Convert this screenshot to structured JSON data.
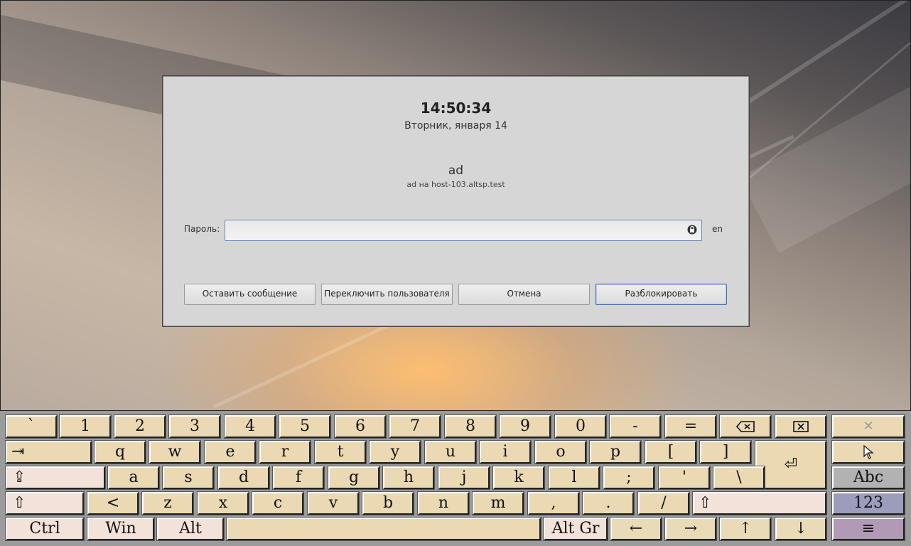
{
  "lock_screen": {
    "time": "14:50:34",
    "date": "Вторник, января 14",
    "user_name": "ad",
    "user_host": "ad на host-103.altsp.test",
    "password_label": "Пароль:",
    "password_value": "",
    "keyboard_layout": "en",
    "buttons": {
      "leave_message": "Оставить сообщение",
      "switch_user": "Переключить пользователя",
      "cancel": "Отмена",
      "unlock": "Разблокировать"
    }
  },
  "keyboard": {
    "row1": [
      "`",
      "1",
      "2",
      "3",
      "4",
      "5",
      "6",
      "7",
      "8",
      "9",
      "0",
      "-",
      "="
    ],
    "row2": [
      "q",
      "w",
      "e",
      "r",
      "t",
      "y",
      "u",
      "i",
      "o",
      "p",
      "[",
      "]"
    ],
    "row3": [
      "a",
      "s",
      "d",
      "f",
      "g",
      "h",
      "j",
      "k",
      "l",
      ";",
      "'",
      "\\"
    ],
    "row4": [
      "<",
      "z",
      "x",
      "c",
      "v",
      "b",
      "n",
      "m",
      ",",
      ".",
      "/"
    ],
    "ctrl": "Ctrl",
    "win": "Win",
    "alt": "Alt",
    "alt_gr": "Alt Gr",
    "tab": "⇥",
    "caps": "⇪",
    "shift": "⇧",
    "enter": "⏎",
    "arrows": {
      "left": "←",
      "right": "→",
      "up": "↑",
      "down": "↓"
    },
    "side": {
      "close": "✕",
      "abc": "Abc",
      "num": "123",
      "menu": "≡"
    }
  },
  "colors": {
    "key_face": "#ead9b3",
    "key_light": "#f2e2d9",
    "key_blue": "#9c9cbc",
    "key_purple": "#b09ab6"
  }
}
